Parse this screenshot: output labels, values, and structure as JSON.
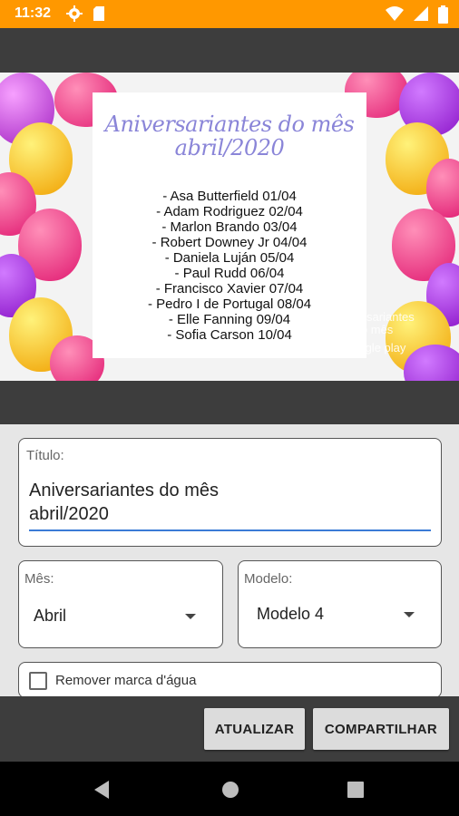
{
  "status_bar": {
    "time": "11:32",
    "icons": [
      "gear-icon",
      "sd-card-icon",
      "wifi-icon",
      "signal-icon",
      "battery-icon"
    ]
  },
  "preview": {
    "card_title_line1": "Aniversariantes do mês",
    "card_title_line2": "abril/2020",
    "birthdays": [
      "- Asa Butterfield 01/04",
      "- Adam Rodriguez 02/04",
      "- Marlon Brando 03/04",
      "- Robert Downey Jr 04/04",
      "- Daniela Luján 05/04",
      "- Paul Rudd 06/04",
      "- Francisco Xavier 07/04",
      "- Pedro I de Portugal 08/04",
      "- Elle Fanning 09/04",
      "- Sofia Carson 10/04"
    ],
    "watermark_line1": "Aniversariantes",
    "watermark_line2": "do mês",
    "watermark_store": "Google play"
  },
  "form": {
    "title_label": "Título:",
    "title_value": "Aniversariantes do mês\nabril/2020",
    "month_label": "Mês:",
    "month_value": "Abril",
    "model_label": "Modelo:",
    "model_value": "Modelo 4",
    "watermark_checkbox_label": "Remover marca d'água",
    "watermark_checked": false
  },
  "actions": {
    "update_label": "ATUALIZAR",
    "share_label": "COMPARTILHAR"
  },
  "colors": {
    "status_bar": "#ff9800",
    "title_purple": "#8a85d8",
    "input_underline": "#3b7bd6"
  }
}
